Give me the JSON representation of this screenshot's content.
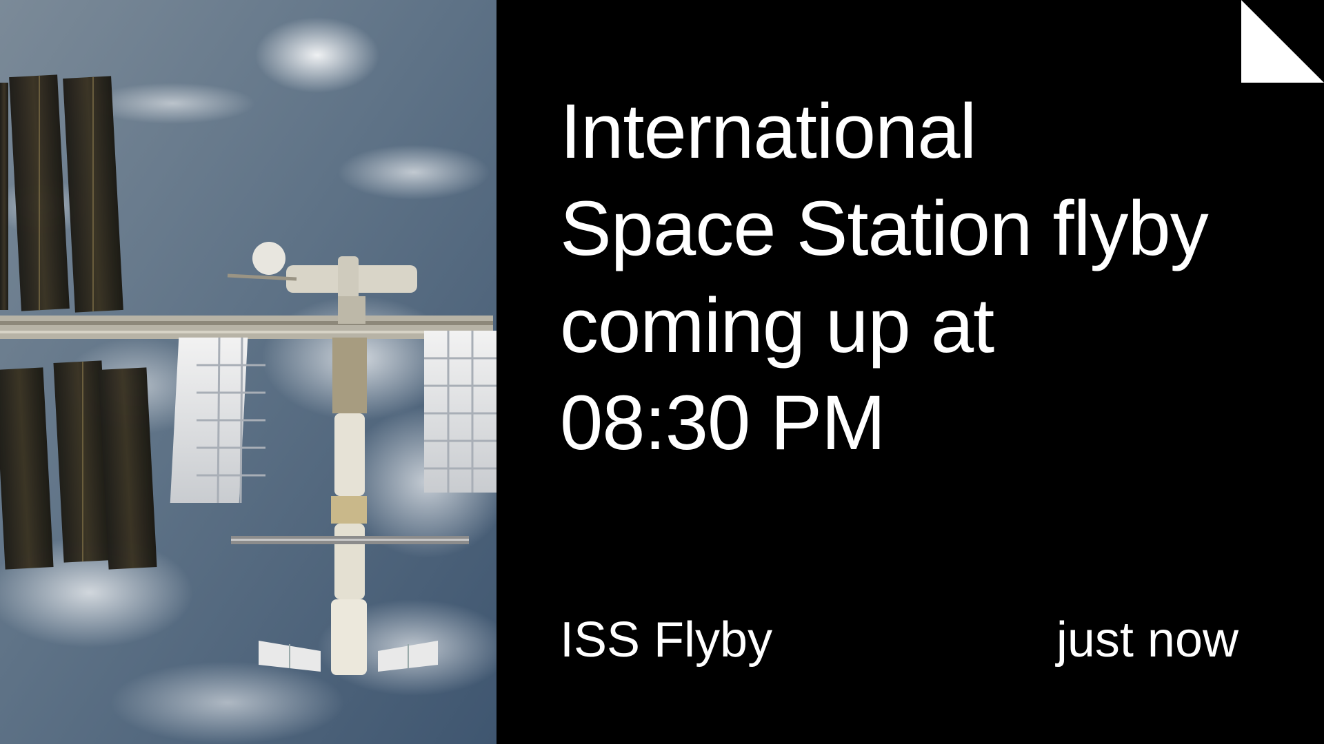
{
  "card": {
    "text": "International\nSpace Station flyby\ncoming up at\n08:30 PM",
    "footer_label": "ISS Flyby",
    "footer_time": "just now"
  },
  "image": {
    "subject": "space-station-over-earth"
  },
  "icons": {
    "corner": "page-curl-icon"
  },
  "colors": {
    "background": "#000000",
    "text": "#ffffff"
  }
}
